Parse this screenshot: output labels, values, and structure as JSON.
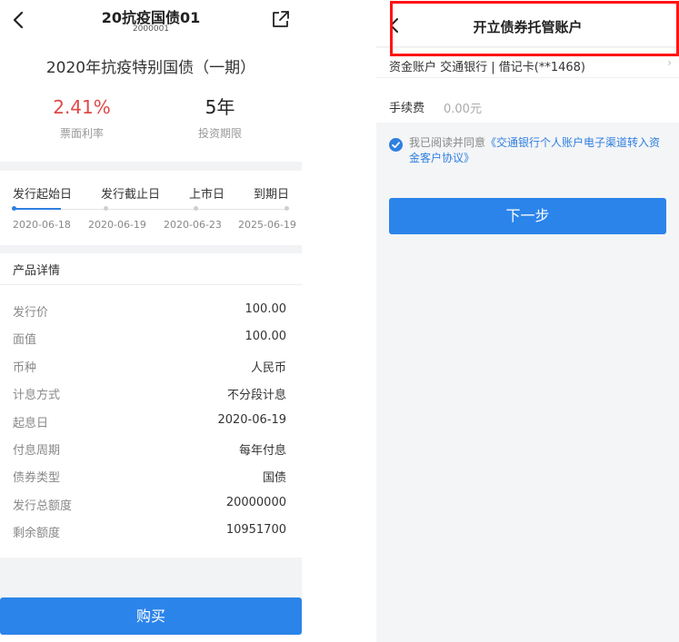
{
  "left": {
    "nav": {
      "title": "20抗疫国债01",
      "code": "2000001"
    },
    "bond_name": "2020年抗疫特别国债（一期）",
    "stats": {
      "rate_value": "2.41%",
      "rate_label": "票面利率",
      "term_value": "5年",
      "term_label": "投资期限"
    },
    "timeline": {
      "labels": [
        "发行起始日",
        "发行截止日",
        "上市日",
        "到期日"
      ],
      "dates": [
        "2020-06-18",
        "2020-06-19",
        "2020-06-23",
        "2025-06-19"
      ]
    },
    "details": {
      "title": "产品详情",
      "rows": [
        {
          "key": "发行价",
          "value": "100.00"
        },
        {
          "key": "面值",
          "value": "100.00"
        },
        {
          "key": "币种",
          "value": "人民币"
        },
        {
          "key": "计息方式",
          "value": "不分段计息"
        },
        {
          "key": "起息日",
          "value": "2020-06-19"
        },
        {
          "key": "付息周期",
          "value": "每年付息"
        },
        {
          "key": "债券类型",
          "value": "国债"
        },
        {
          "key": "发行总额度",
          "value": "20000000"
        },
        {
          "key": "剩余额度",
          "value": "10951700"
        }
      ]
    },
    "buy_label": "购买"
  },
  "right": {
    "nav": {
      "title": "开立债券托管账户"
    },
    "account_text": "资金账户  交通银行 | 借记卡(**1468)",
    "fee": {
      "label": "手续费",
      "value": "0.00元"
    },
    "agreement": {
      "prefix": "我已阅读并同意",
      "link": "《交通银行个人账户电子渠道转入资金客户协议》"
    },
    "next_label": "下一步"
  },
  "colors": {
    "accent": "#2b84ea",
    "rate": "#e04848",
    "highlight": "#ff1414"
  },
  "icons": [
    "back-arrow-icon",
    "share-icon",
    "checkmark-icon",
    "chevron-right-icon"
  ]
}
